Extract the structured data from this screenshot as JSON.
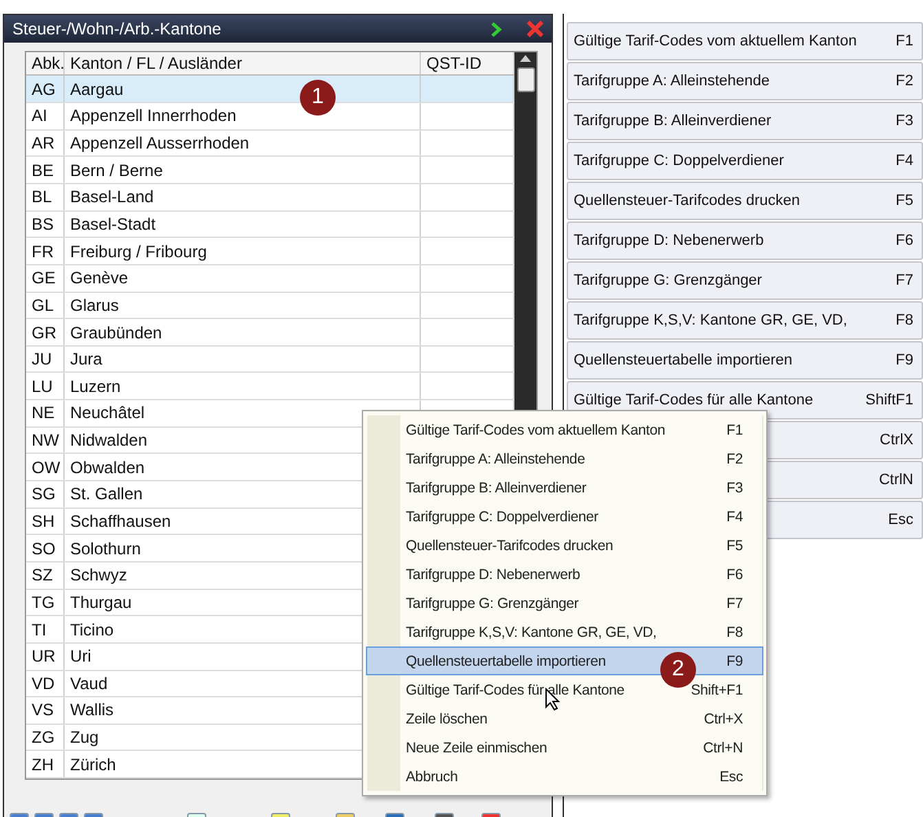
{
  "window": {
    "title": "Steuer-/Wohn-/Arb.-Kantone"
  },
  "table": {
    "columns": [
      "Abk.",
      "Kanton / FL / Ausländer",
      "QST-ID"
    ],
    "rows": [
      {
        "code": "AG",
        "name": "Aargau",
        "selected": true
      },
      {
        "code": "AI",
        "name": "Appenzell Innerrhoden",
        "selected": false
      },
      {
        "code": "AR",
        "name": "Appenzell Ausserrhoden",
        "selected": false
      },
      {
        "code": "BE",
        "name": "Bern / Berne",
        "selected": false
      },
      {
        "code": "BL",
        "name": "Basel-Land",
        "selected": false
      },
      {
        "code": "BS",
        "name": "Basel-Stadt",
        "selected": false
      },
      {
        "code": "FR",
        "name": "Freiburg / Fribourg",
        "selected": false
      },
      {
        "code": "GE",
        "name": "Genève",
        "selected": false
      },
      {
        "code": "GL",
        "name": "Glarus",
        "selected": false
      },
      {
        "code": "GR",
        "name": "Graubünden",
        "selected": false
      },
      {
        "code": "JU",
        "name": "Jura",
        "selected": false
      },
      {
        "code": "LU",
        "name": "Luzern",
        "selected": false
      },
      {
        "code": "NE",
        "name": "Neuchâtel",
        "selected": false
      },
      {
        "code": "NW",
        "name": "Nidwalden",
        "selected": false
      },
      {
        "code": "OW",
        "name": "Obwalden",
        "selected": false
      },
      {
        "code": "SG",
        "name": "St. Gallen",
        "selected": false
      },
      {
        "code": "SH",
        "name": "Schaffhausen",
        "selected": false
      },
      {
        "code": "SO",
        "name": "Solothurn",
        "selected": false
      },
      {
        "code": "SZ",
        "name": "Schwyz",
        "selected": false
      },
      {
        "code": "TG",
        "name": "Thurgau",
        "selected": false
      },
      {
        "code": "TI",
        "name": "Ticino",
        "selected": false
      },
      {
        "code": "UR",
        "name": "Uri",
        "selected": false
      },
      {
        "code": "VD",
        "name": "Vaud",
        "selected": false
      },
      {
        "code": "VS",
        "name": "Wallis",
        "selected": false
      },
      {
        "code": "ZG",
        "name": "Zug",
        "selected": false
      },
      {
        "code": "ZH",
        "name": "Zürich",
        "selected": false
      }
    ]
  },
  "side_buttons": [
    {
      "label": "Gültige Tarif-Codes vom aktuellem Kanton",
      "shortcut": "F1"
    },
    {
      "label": "Tarifgruppe A: Alleinstehende",
      "shortcut": "F2"
    },
    {
      "label": "Tarifgruppe B: Alleinverdiener",
      "shortcut": "F3"
    },
    {
      "label": "Tarifgruppe C: Doppelverdiener",
      "shortcut": "F4"
    },
    {
      "label": "Quellensteuer-Tarifcodes drucken",
      "shortcut": "F5"
    },
    {
      "label": "Tarifgruppe D: Nebenerwerb",
      "shortcut": "F6"
    },
    {
      "label": "Tarifgruppe G: Grenzgänger",
      "shortcut": "F7"
    },
    {
      "label": "Tarifgruppe K,S,V: Kantone GR, GE, VD,",
      "shortcut": "F8"
    },
    {
      "label": "Quellensteuertabelle importieren",
      "shortcut": "F9"
    },
    {
      "label": "Gültige Tarif-Codes für alle Kantone",
      "shortcut": "ShiftF1"
    },
    {
      "shortcut": "CtrlX"
    },
    {
      "shortcut": "CtrlN"
    },
    {
      "shortcut": "Esc"
    }
  ],
  "context_menu": [
    {
      "label": "Gültige Tarif-Codes vom aktuellem Kanton",
      "shortcut": "F1",
      "selected": false
    },
    {
      "label": "Tarifgruppe A: Alleinstehende",
      "shortcut": "F2",
      "selected": false
    },
    {
      "label": "Tarifgruppe B: Alleinverdiener",
      "shortcut": "F3",
      "selected": false
    },
    {
      "label": "Tarifgruppe C: Doppelverdiener",
      "shortcut": "F4",
      "selected": false
    },
    {
      "label": "Quellensteuer-Tarifcodes drucken",
      "shortcut": "F5",
      "selected": false
    },
    {
      "label": "Tarifgruppe D: Nebenerwerb",
      "shortcut": "F6",
      "selected": false
    },
    {
      "label": "Tarifgruppe G: Grenzgänger",
      "shortcut": "F7",
      "selected": false
    },
    {
      "label": "Tarifgruppe K,S,V: Kantone GR, GE, VD,",
      "shortcut": "F8",
      "selected": false
    },
    {
      "label": "Quellensteuertabelle importieren",
      "shortcut": "F9",
      "selected": true
    },
    {
      "label": "Gültige Tarif-Codes für alle Kantone",
      "shortcut": "Shift+F1",
      "selected": false
    },
    {
      "label": "Zeile löschen",
      "shortcut": "Ctrl+X",
      "selected": false
    },
    {
      "label": "Neue Zeile einmischen",
      "shortcut": "Ctrl+N",
      "selected": false
    },
    {
      "label": "Abbruch",
      "shortcut": "Esc",
      "selected": false
    }
  ],
  "callouts": [
    "1",
    "2"
  ]
}
